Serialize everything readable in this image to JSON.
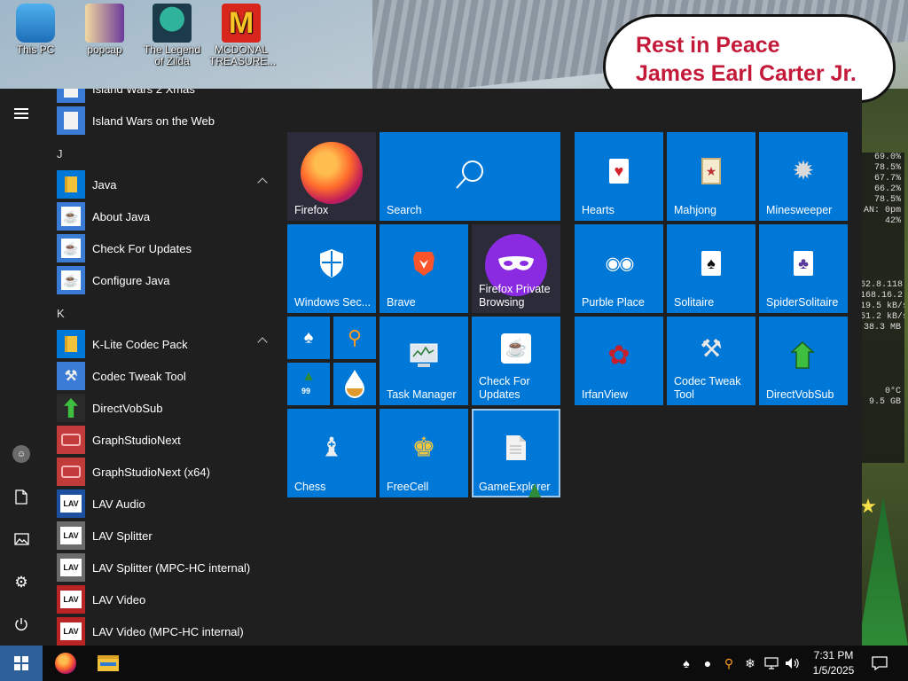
{
  "desktop": {
    "icons": [
      {
        "label": "This PC",
        "icon": "computer-icon"
      },
      {
        "label": "popcap",
        "icon": "popcap-icon"
      },
      {
        "label": "The Legend of Zilda",
        "icon": "zelda-icon"
      },
      {
        "label": "MCDONAL TREASURE...",
        "icon": "mcdonalds-icon"
      }
    ],
    "banner": {
      "line1": "Rest in Peace",
      "line2": "James Earl Carter Jr."
    },
    "widget_lines": [
      "69.0%",
      "78.5%",
      "67.7%",
      "66.2%",
      "78.5%",
      "AN: 0pm",
      "42%",
      "",
      "",
      "",
      "",
      "",
      "62.8.118",
      "168.16.2",
      "19.5 kB/s",
      "51.2 kB/s",
      "38.3 MB",
      "",
      "",
      "",
      "",
      "",
      "0°C",
      "9.5 GB"
    ]
  },
  "start_menu": {
    "menu_icon": "hamburger-icon",
    "app_list": {
      "items": [
        {
          "type": "app",
          "label": "Island Wars 2 Xmas",
          "icon": "document-icon",
          "color": "#3a7bd5"
        },
        {
          "type": "app",
          "label": "Island Wars on the Web",
          "icon": "document-icon",
          "color": "#3a7bd5"
        },
        {
          "type": "letter",
          "label": "J"
        },
        {
          "type": "folder",
          "label": "Java",
          "icon": "folder-icon",
          "color": "#0078d7"
        },
        {
          "type": "app",
          "label": "About Java",
          "icon": "java-icon",
          "color": "#3a7bd5"
        },
        {
          "type": "app",
          "label": "Check For Updates",
          "icon": "java-icon",
          "color": "#3a7bd5"
        },
        {
          "type": "app",
          "label": "Configure Java",
          "icon": "java-icon",
          "color": "#3a7bd5"
        },
        {
          "type": "letter",
          "label": "K"
        },
        {
          "type": "folder",
          "label": "K-Lite Codec Pack",
          "icon": "folder-icon",
          "color": "#0078d7"
        },
        {
          "type": "app",
          "label": "Codec Tweak Tool",
          "icon": "tools-icon",
          "color": "#3a7bd5"
        },
        {
          "type": "app",
          "label": "DirectVobSub",
          "icon": "green-arrow-icon",
          "color": "#2a2a2a"
        },
        {
          "type": "app",
          "label": "GraphStudioNext",
          "icon": "graph-icon",
          "color": "#c23b3b"
        },
        {
          "type": "app",
          "label": "GraphStudioNext (x64)",
          "icon": "graph-icon",
          "color": "#c23b3b"
        },
        {
          "type": "app",
          "label": "LAV Audio",
          "icon": "lav-icon",
          "color": "#1c4fa0"
        },
        {
          "type": "app",
          "label": "LAV Splitter",
          "icon": "lav-icon",
          "color": "#6b6b6b"
        },
        {
          "type": "app",
          "label": "LAV Splitter (MPC-HC internal)",
          "icon": "lav-icon",
          "color": "#6b6b6b"
        },
        {
          "type": "app",
          "label": "LAV Video",
          "icon": "lav-icon",
          "color": "#b82424"
        },
        {
          "type": "app",
          "label": "LAV Video (MPC-HC internal)",
          "icon": "lav-icon",
          "color": "#b82424"
        }
      ]
    },
    "tiles": {
      "firefox": "Firefox",
      "search": "Search",
      "windows_security": "Windows Sec...",
      "brave": "Brave",
      "firefox_private": "Firefox Private Browsing",
      "task_manager": "Task Manager",
      "check_updates": "Check For Updates",
      "chess": "Chess",
      "freecell": "FreeCell",
      "game_explorer": "GameExplorer",
      "hearts": "Hearts",
      "mahjong": "Mahjong",
      "minesweeper": "Minesweeper",
      "purble_place": "Purble Place",
      "solitaire": "Solitaire",
      "spider_solitaire": "SpiderSolitaire",
      "irfanview": "IrfanView",
      "codec_tweak": "Codec Tweak Tool",
      "directvobsub": "DirectVobSub",
      "mini_badge": "99"
    }
  },
  "taskbar": {
    "clock_time": "7:31 PM",
    "clock_date": "1/5/2025",
    "pinned": [
      "firefox-icon",
      "file-explorer-icon"
    ]
  }
}
